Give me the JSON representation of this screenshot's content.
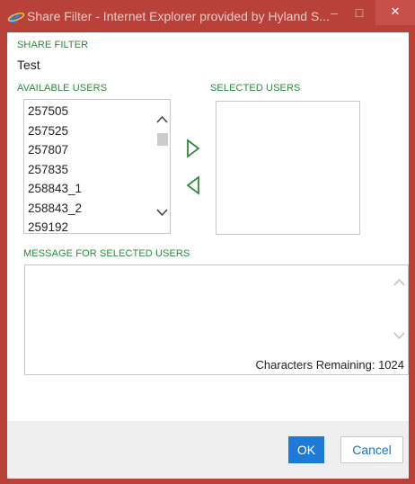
{
  "window": {
    "title": "Share Filter - Internet Explorer provided by Hyland S...",
    "minimize_glyph": "–",
    "maximize_glyph": "□",
    "close_glyph": "✕",
    "frame_color": "#b8413a",
    "icon": "internet-explorer-icon"
  },
  "share_filter": {
    "label": "SHARE FILTER",
    "value": "Test"
  },
  "available_users": {
    "label": "AVAILABLE USERS",
    "items": [
      "257505",
      "257525",
      "257807",
      "257835",
      "258843_1",
      "258843_2",
      "259192"
    ]
  },
  "selected_users": {
    "label": "SELECTED USERS",
    "items": []
  },
  "move_buttons": {
    "add_icon": "triangle-right-outline-icon",
    "remove_icon": "triangle-left-outline-icon",
    "color": "#2d8a3e"
  },
  "message": {
    "label": "MESSAGE FOR SELECTED USERS",
    "value": "",
    "chars_remaining": "Characters Remaining: 1024"
  },
  "footer": {
    "ok_label": "OK",
    "cancel_label": "Cancel",
    "accent": "#1e7ad6"
  }
}
